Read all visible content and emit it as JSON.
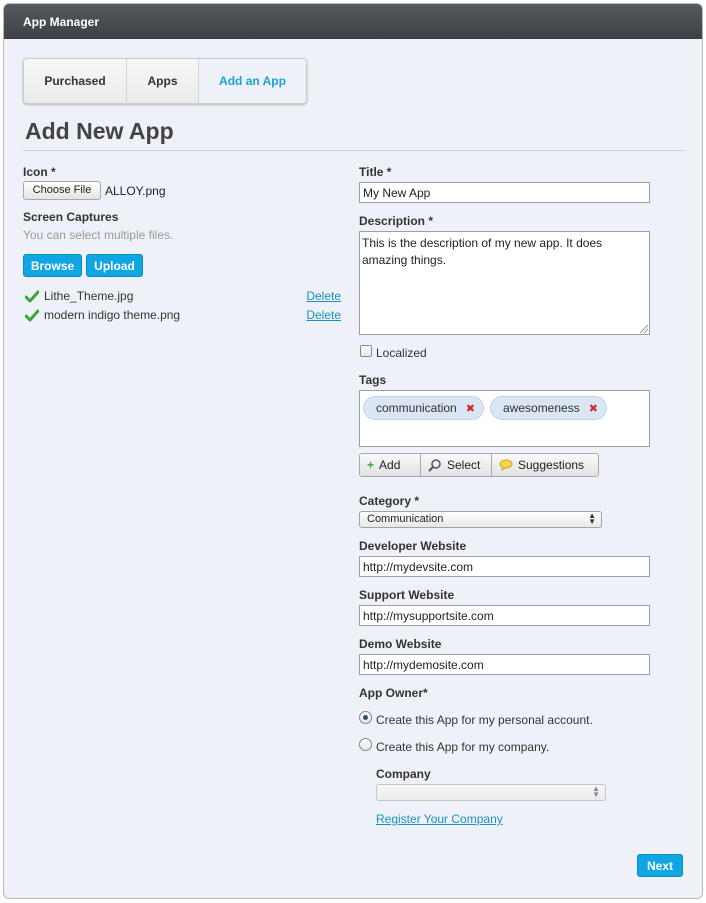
{
  "app": {
    "title": "App Manager"
  },
  "tabs": [
    {
      "label": "Purchased"
    },
    {
      "label": "Apps"
    },
    {
      "label": "Add an App"
    }
  ],
  "page": {
    "title": "Add New App"
  },
  "icon_field": {
    "label": "Icon *",
    "button": "Choose File",
    "file": "ALLOY.png"
  },
  "screen_captures": {
    "label": "Screen Captures",
    "hint": "You can select multiple files.",
    "browse": "Browse",
    "upload": "Upload",
    "files": [
      {
        "name": "Lithe_Theme.jpg",
        "action": "Delete"
      },
      {
        "name": "modern indigo theme.png",
        "action": "Delete"
      }
    ]
  },
  "title_field": {
    "label": "Title *",
    "value": "My New App"
  },
  "description": {
    "label": "Description *",
    "value": "This is the description of my new app.  It does amazing things."
  },
  "localized": {
    "label": "Localized",
    "checked": false
  },
  "tags": {
    "label": "Tags",
    "items": [
      {
        "label": "communication"
      },
      {
        "label": "awesomeness"
      }
    ],
    "buttons": {
      "add": "Add",
      "select": "Select",
      "suggestions": "Suggestions"
    }
  },
  "category": {
    "label": "Category *",
    "value": "Communication"
  },
  "developer_website": {
    "label": "Developer Website",
    "value": "http://mydevsite.com"
  },
  "support_website": {
    "label": "Support Website",
    "value": "http://mysupportsite.com"
  },
  "demo_website": {
    "label": "Demo Website",
    "value": "http://mydemosite.com"
  },
  "app_owner": {
    "label": "App Owner*",
    "options": [
      {
        "label": "Create this App for my personal account.",
        "selected": true
      },
      {
        "label": "Create this App for my company.",
        "selected": false
      }
    ]
  },
  "company": {
    "label": "Company",
    "value": "",
    "register_link": "Register Your Company"
  },
  "next_button": "Next",
  "colors": {
    "accent": "#0fa6e3",
    "link": "#1a8fc7",
    "titlebar": "#4a4e52",
    "background": "#eef2f8"
  }
}
